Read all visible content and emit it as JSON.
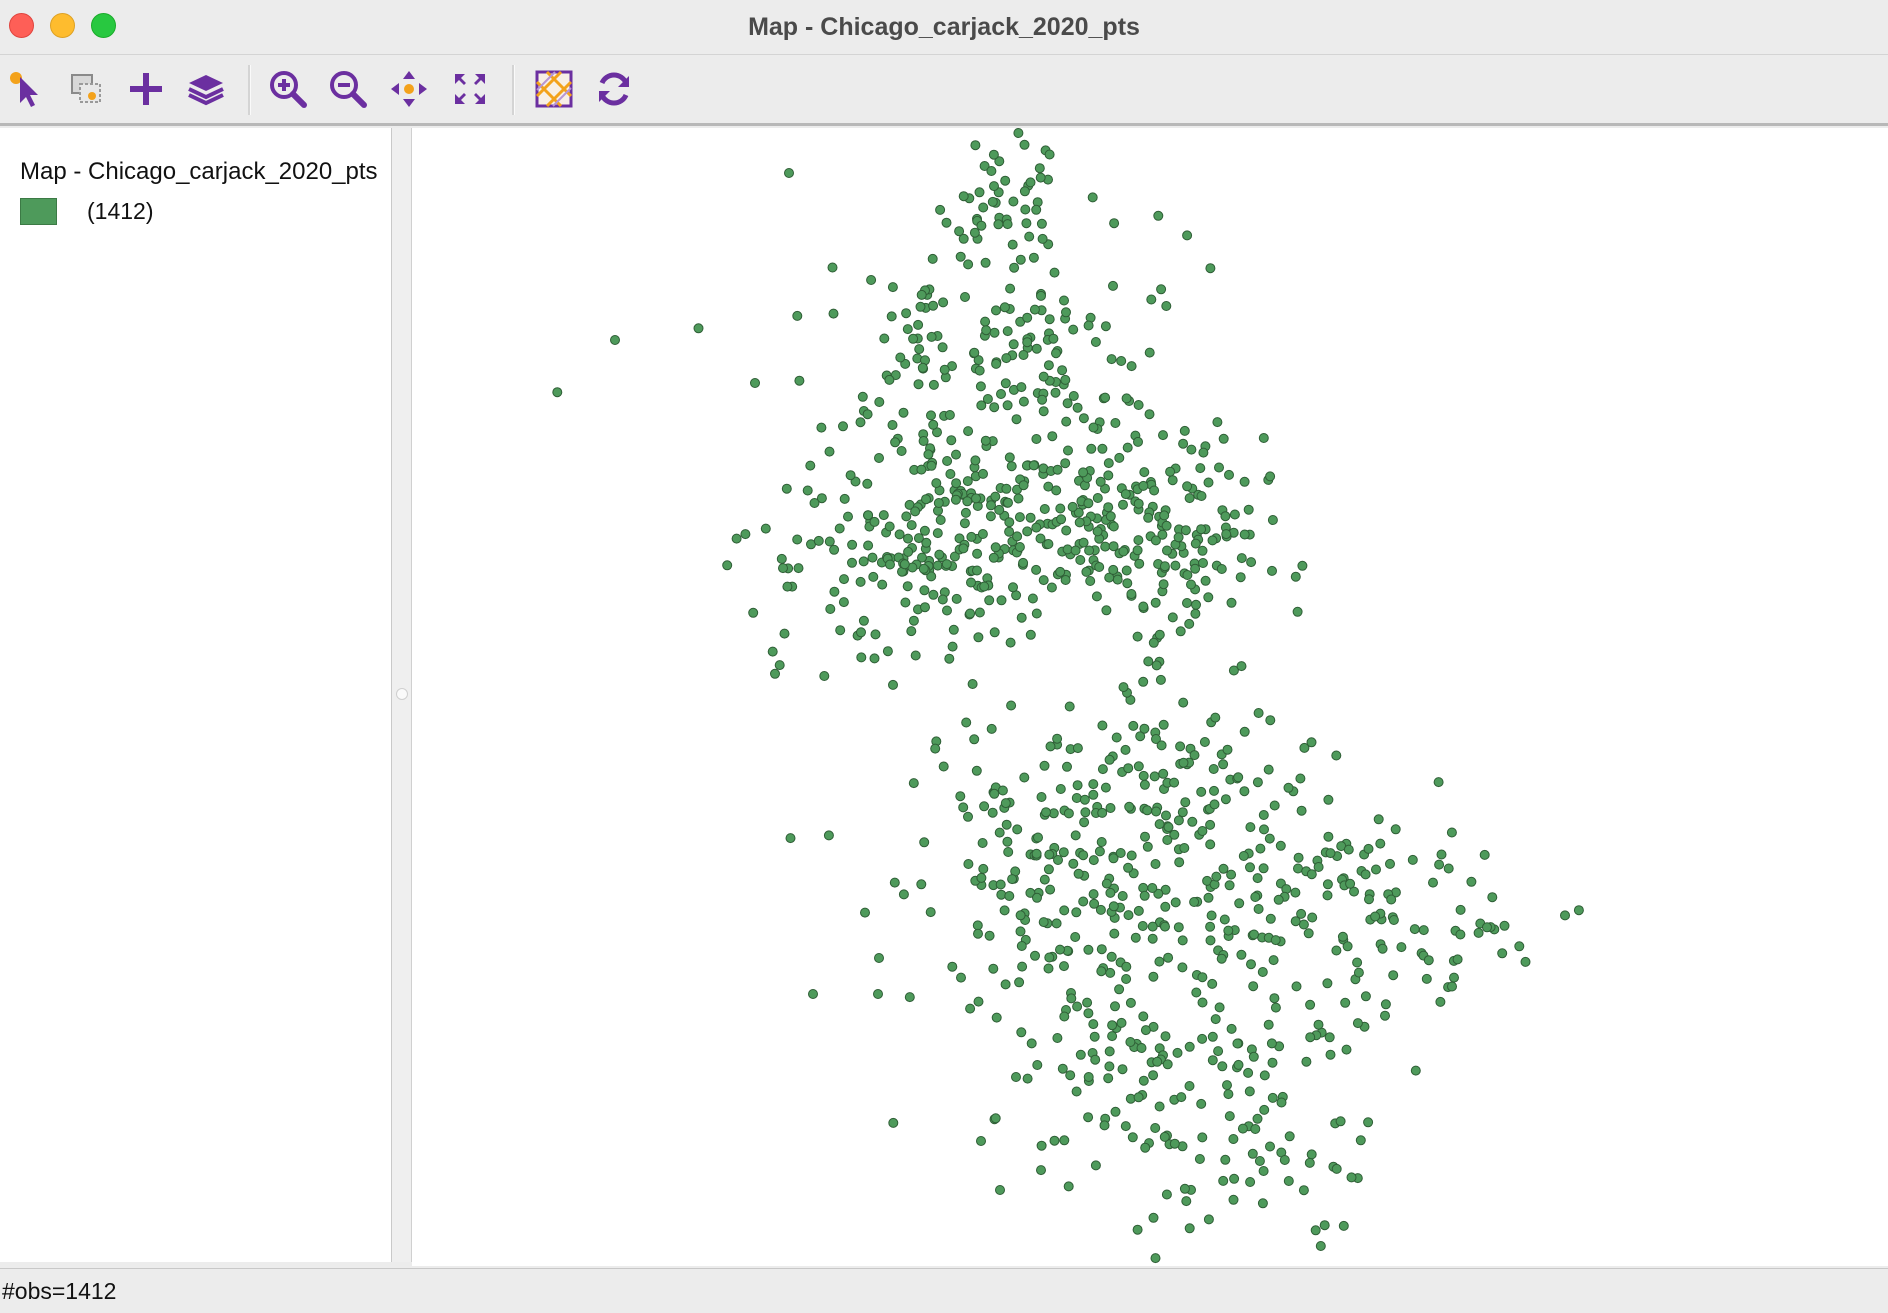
{
  "window": {
    "title": "Map - Chicago_carjack_2020_pts"
  },
  "toolbar": {
    "buttons": [
      {
        "icon": "select-pointer-icon"
      },
      {
        "icon": "selection-tools-icon"
      },
      {
        "icon": "add-icon"
      },
      {
        "icon": "layers-icon"
      },
      {
        "icon": "zoom-in-icon"
      },
      {
        "icon": "zoom-out-icon"
      },
      {
        "icon": "pan-icon"
      },
      {
        "icon": "full-extent-icon"
      },
      {
        "icon": "basemap-icon"
      },
      {
        "icon": "refresh-icon"
      }
    ]
  },
  "legend": {
    "title": "Map - Chicago_carjack_2020_pts",
    "items": [
      {
        "label": "(1412)",
        "color": "#4e9a5b"
      }
    ]
  },
  "map": {
    "point_color": "#4e9a5b",
    "point_outline": "#2f5e36"
  },
  "status": {
    "text": "#obs=1412"
  },
  "colors": {
    "icon_purple": "#6b2fa0",
    "icon_orange": "#f3a21b"
  }
}
